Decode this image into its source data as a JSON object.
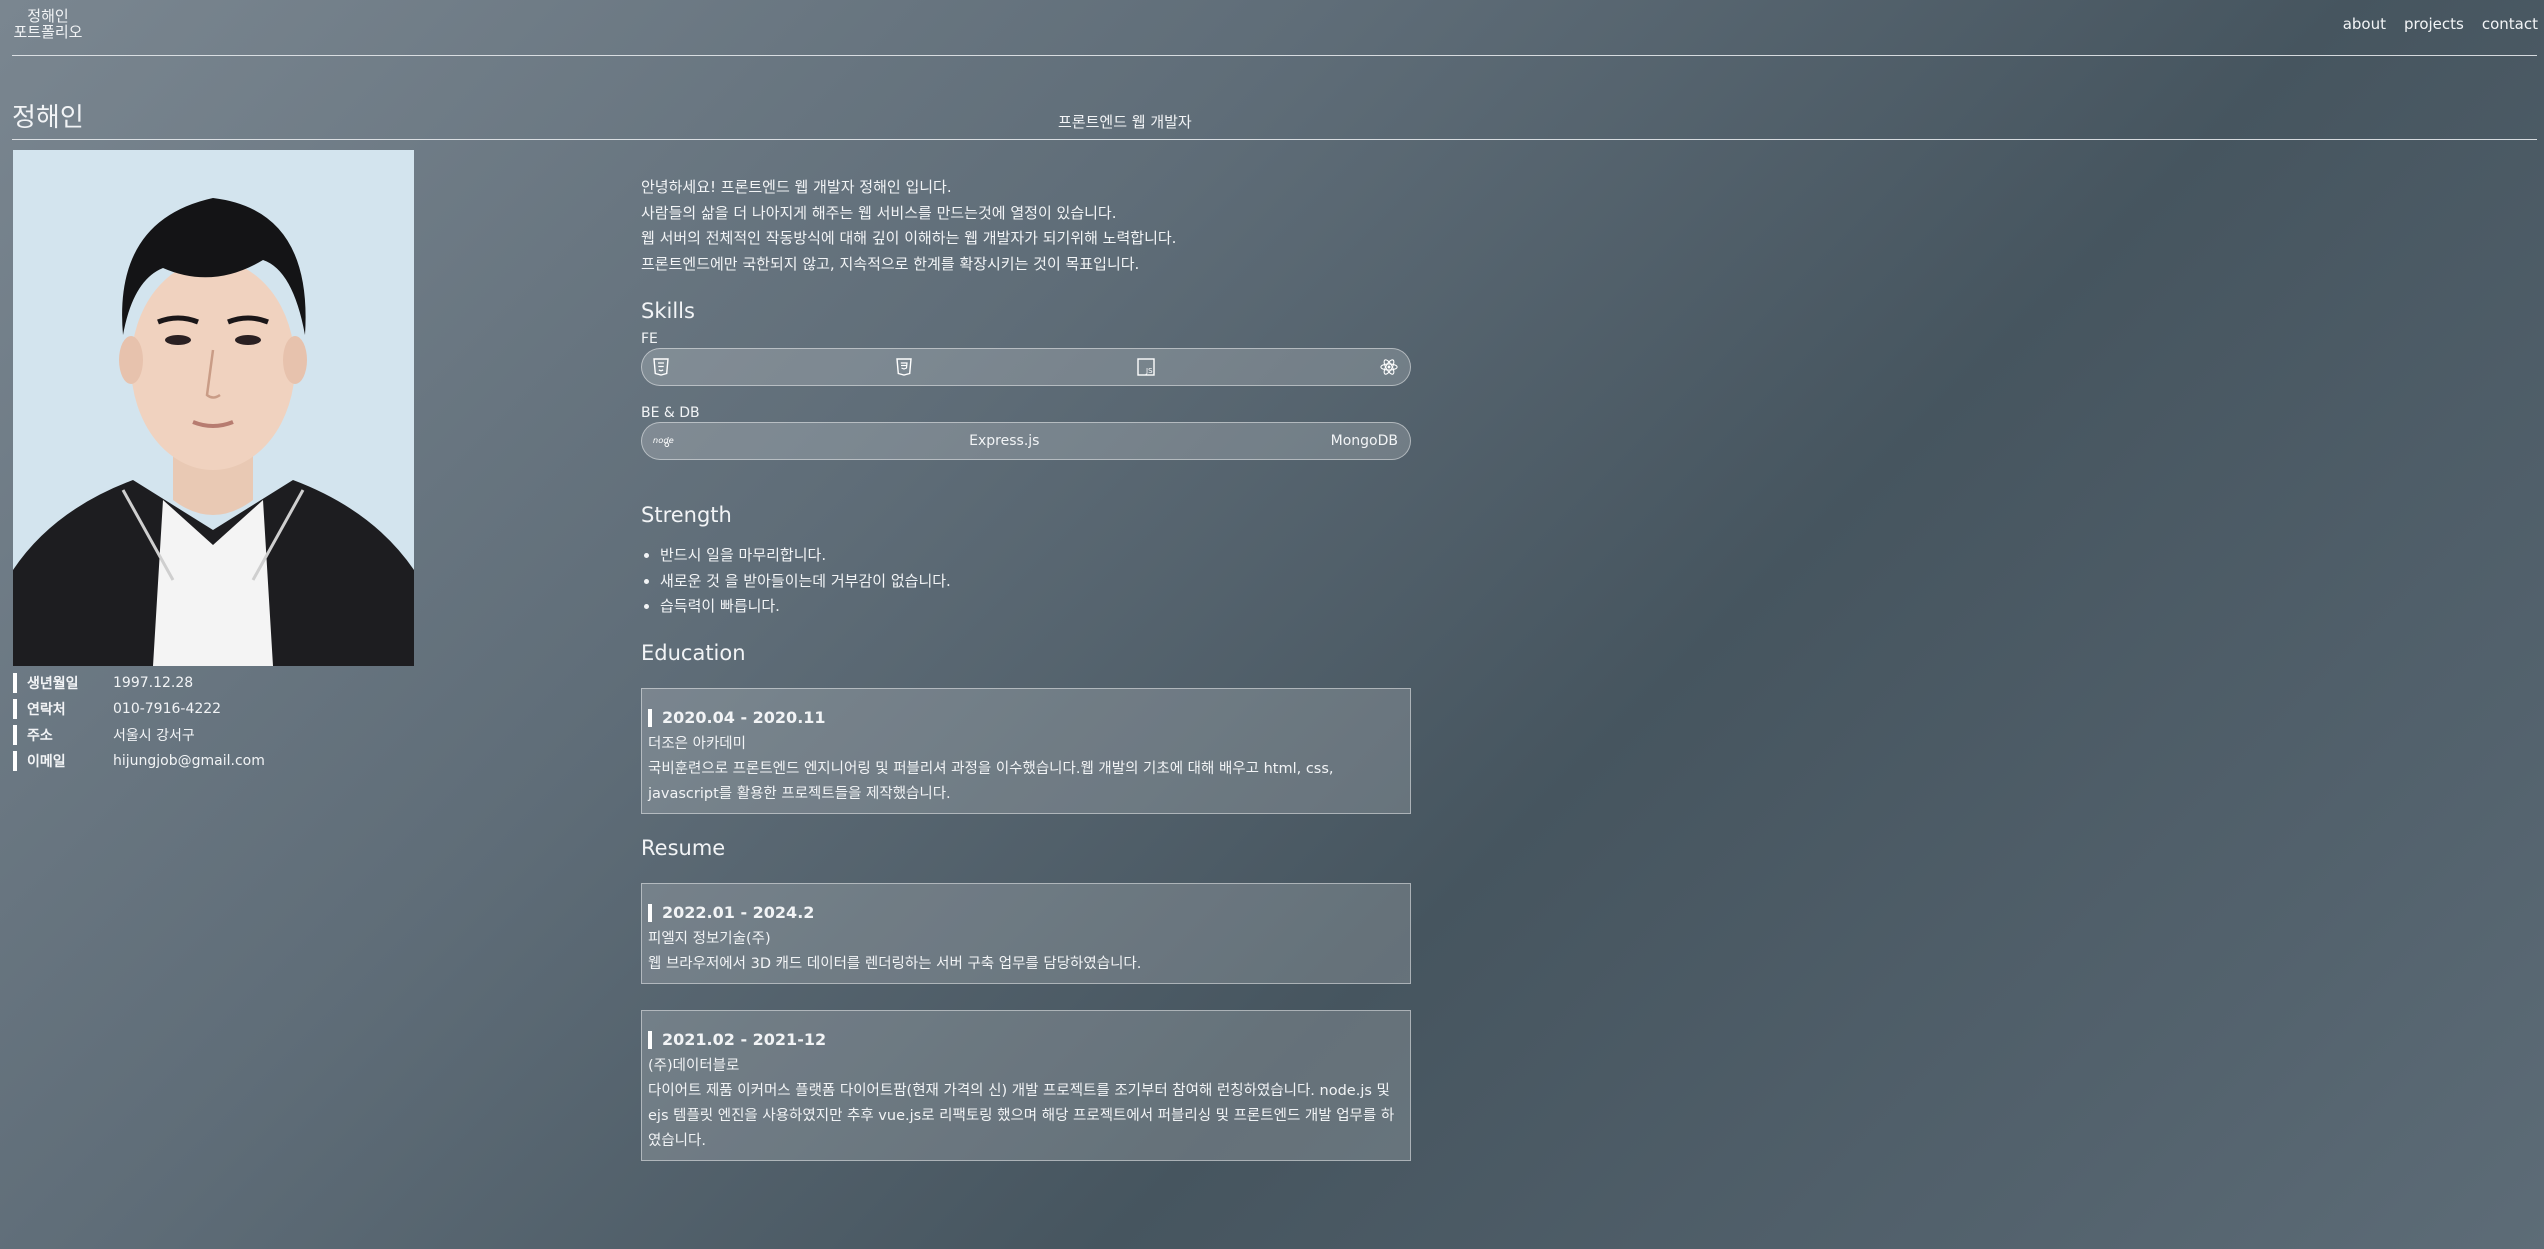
{
  "header": {
    "logo_line1": "정해인",
    "logo_line2": "포트폴리오",
    "nav": [
      "about",
      "projects",
      "contact"
    ]
  },
  "profile": {
    "name": "정해인",
    "subtitle": "프론트엔드 웹 개발자",
    "info": [
      {
        "label": "생년월일",
        "value": "1997.12.28"
      },
      {
        "label": "연락처",
        "value": "010-7916-4222"
      },
      {
        "label": "주소",
        "value": "서울시 강서구"
      },
      {
        "label": "이메일",
        "value": "hijungjob@gmail.com"
      }
    ]
  },
  "intro": [
    "안녕하세요! 프론트엔드 웹 개발자 정해인 입니다.",
    "사람들의 삶을 더 나아지게 해주는 웹 서비스를 만드는것에 열정이 있습니다.",
    "웹 서버의 전체적인 작동방식에 대해 깊이 이해하는 웹 개발자가 되기위해 노력합니다.",
    "프론트엔드에만 국한되지 않고, 지속적으로 한계를 확장시키는 것이 목표입니다."
  ],
  "skills": {
    "title": "Skills",
    "fe_label": "FE",
    "fe_icons": [
      "html5-icon",
      "css3-icon",
      "javascript-icon",
      "react-icon"
    ],
    "be_label": "BE & DB",
    "be_items": [
      "nodejs-icon",
      "Express.js",
      "MongoDB"
    ],
    "node_logo_text": "node"
  },
  "strength": {
    "title": "Strength",
    "items": [
      "반드시 일을 마무리합니다.",
      "새로운 것 을 받아들이는데 거부감이 없습니다.",
      "습득력이 빠릅니다."
    ]
  },
  "education": {
    "title": "Education",
    "items": [
      {
        "date": "2020.04 - 2020.11",
        "org": "더조은 아카데미",
        "desc": "국비훈련으로 프론트엔드 엔지니어링 및 퍼블리셔 과정을 이수했습니다.웹 개발의 기초에 대해 배우고 html, css, javascript를 활용한 프로젝트들을 제작했습니다."
      }
    ]
  },
  "resume": {
    "title": "Resume",
    "items": [
      {
        "date": "2022.01 - 2024.2",
        "org": "피엘지 정보기술(주)",
        "desc": "웹 브라우저에서 3D 캐드 데이터를 렌더링하는 서버 구축 업무를 담당하였습니다."
      },
      {
        "date": "2021.02 - 2021-12",
        "org": "(주)데이터블로",
        "desc": "다이어트 제품 이커머스 플랫폼 다이어트팜(현재 가격의 신) 개발 프로젝트를 조기부터 참여해 런칭하였습니다. node.js 및 ejs 템플릿 엔진을 사용하였지만 추후 vue.js로 리팩토링 했으며 해당 프로젝트에서 퍼블리싱 및 프론트엔드 개발 업무를 하였습니다."
      }
    ]
  },
  "colors": {
    "background_start": "#7a8690",
    "background_mid": "#46555f",
    "photo_bg": "#d3e4ee",
    "text": "#f2f4f6"
  }
}
